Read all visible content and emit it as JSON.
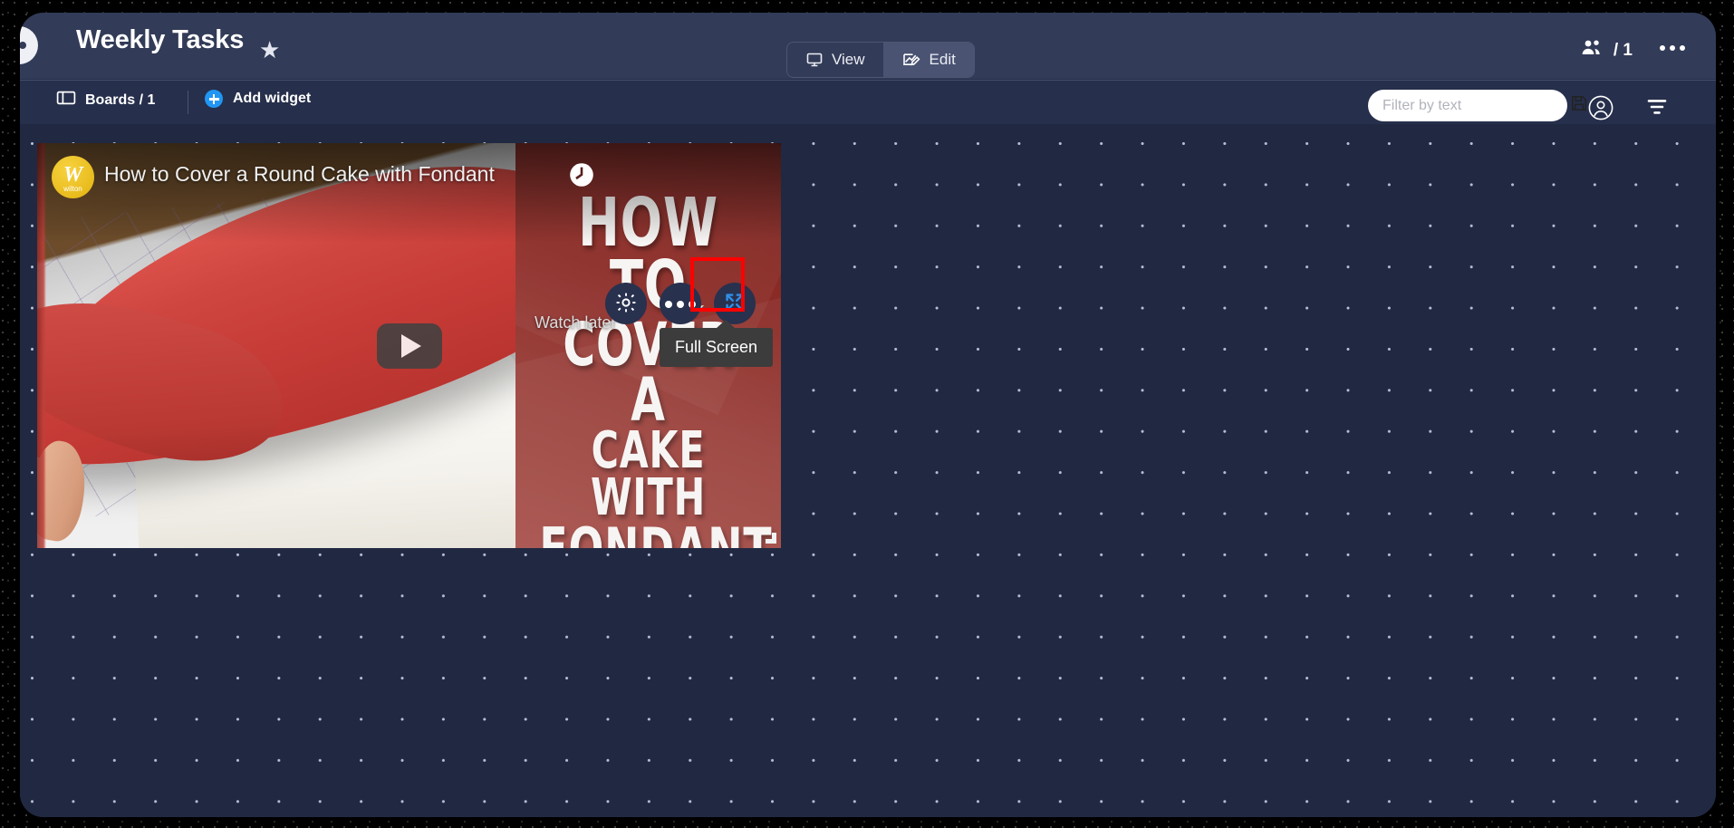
{
  "header": {
    "title": "Weekly Tasks",
    "favorite_icon": "star-icon",
    "logo_icon": "app-logo-icon",
    "view_mode": {
      "view_label": "View",
      "edit_label": "Edit",
      "active": "Edit"
    },
    "collaborators": {
      "icon": "people-icon",
      "count_label": "/ 1"
    },
    "more_menu_icon": "kebab-menu-icon",
    "background_color": "#323b57"
  },
  "toolbar": {
    "boards": {
      "icon": "board-icon",
      "label": "Boards / 1"
    },
    "add_widget": {
      "icon": "plus-circle-icon",
      "label": "Add widget",
      "accent_color": "#2196f3"
    },
    "filter": {
      "placeholder": "Filter by text",
      "value": "",
      "save_icon": "floppy-save-icon"
    },
    "account_icon": "user-circle-icon",
    "filter_icon": "filter-funnel-icon",
    "background_color": "#262f4b"
  },
  "canvas": {
    "background_color": "#212942",
    "dot_color": "#b9bfd3",
    "grid_spacing": 45
  },
  "widget": {
    "type": "youtube-video",
    "video": {
      "title": "How to Cover a Round Cake with Fondant",
      "channel": "wilton",
      "channel_logo_letter": "W",
      "watch_later_label": "Watch later",
      "play_button_icon": "play-icon",
      "thumbnail_text_lines": [
        "HOW TO",
        "COVER A",
        "CAKE WITH",
        "FONDANT"
      ],
      "thumbnail_bg_color": "#8d2c27"
    },
    "controls": [
      {
        "name": "settings-button",
        "icon": "gear-icon"
      },
      {
        "name": "more-options-button",
        "icon": "dots-icon"
      },
      {
        "name": "fullscreen-button",
        "icon": "fullscreen-expand-icon",
        "accent_color": "#2f8fe8",
        "highlighted": true
      }
    ],
    "tooltip": {
      "text": "Full Screen",
      "background_color": "#3c3c3c"
    },
    "highlight_color": "#ff0000",
    "resize_handle_icon": "resize-handle-icon"
  }
}
